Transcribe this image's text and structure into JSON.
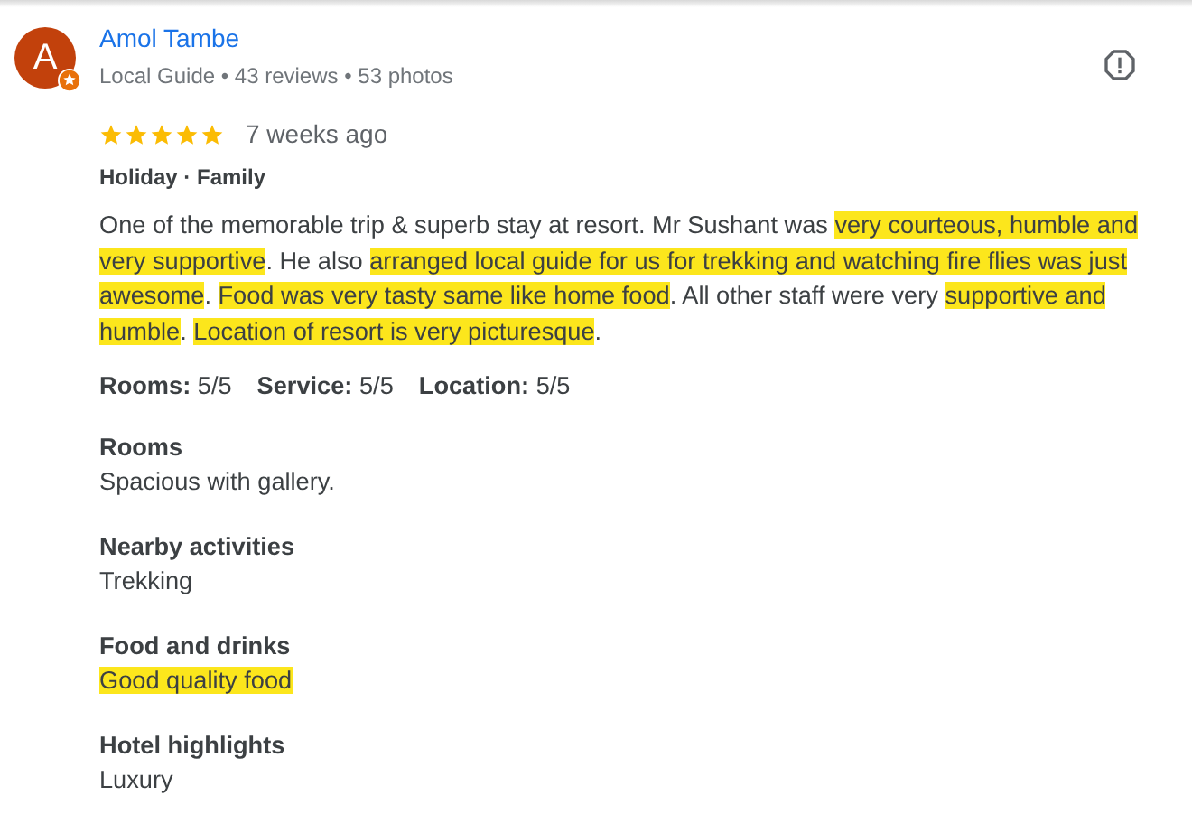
{
  "reviewer": {
    "initial": "A",
    "name": "Amol Tambe",
    "meta": "Local Guide • 43 reviews • 53 photos",
    "local_guide": true
  },
  "review": {
    "stars": 5,
    "time": "7 weeks ago",
    "trip": "Holiday · Family",
    "body": [
      {
        "text": "One of the memorable trip & superb stay at resort. Mr Sushant was ",
        "highlighted": false
      },
      {
        "text": "very courteous, humble and very supportive",
        "highlighted": true
      },
      {
        "text": ". He also ",
        "highlighted": false
      },
      {
        "text": "arranged local guide for us for trekking and watching fire flies was just awesome",
        "highlighted": true
      },
      {
        "text": ". ",
        "highlighted": false
      },
      {
        "text": "Food was very tasty same like home food",
        "highlighted": true
      },
      {
        "text": ". All other staff were very ",
        "highlighted": false
      },
      {
        "text": "supportive and humble",
        "highlighted": true
      },
      {
        "text": ". ",
        "highlighted": false
      },
      {
        "text": "Location of resort is very picturesque",
        "highlighted": true
      },
      {
        "text": ".",
        "highlighted": false
      }
    ],
    "ratings": [
      {
        "label": "Rooms:",
        "value": "5/5"
      },
      {
        "label": "Service:",
        "value": "5/5"
      },
      {
        "label": "Location:",
        "value": "5/5"
      }
    ],
    "sections": [
      {
        "heading": "Rooms",
        "text": "Spacious with gallery.",
        "highlighted": false
      },
      {
        "heading": "Nearby activities",
        "text": "Trekking",
        "highlighted": false
      },
      {
        "heading": "Food and drinks",
        "text": "Good quality food",
        "highlighted": true
      },
      {
        "heading": "Hotel highlights",
        "text": "Luxury",
        "highlighted": false
      }
    ]
  }
}
